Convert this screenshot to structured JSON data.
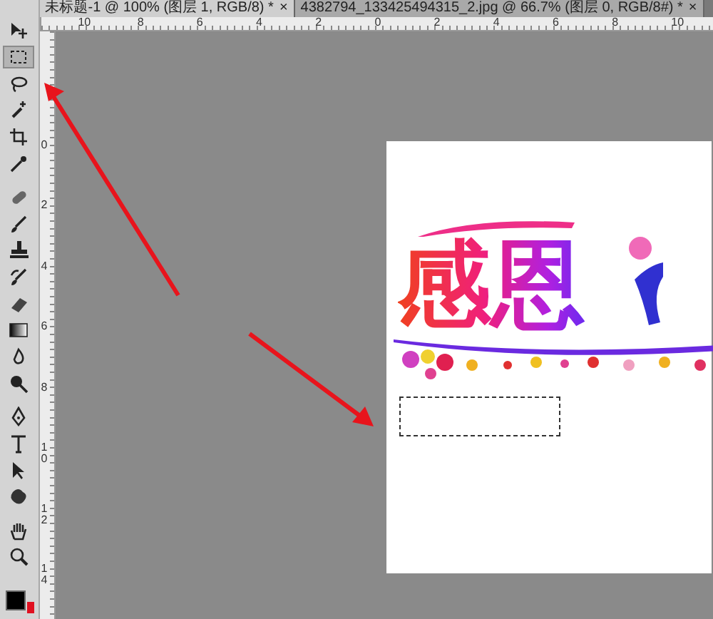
{
  "document_tabs": [
    {
      "label": "未标题-1 @ 100% (图层 1, RGB/8) *",
      "close": "×",
      "selected": true
    },
    {
      "label": "4382794_133425494315_2.jpg @ 66.7% (图层 0, RGB/8#) *",
      "close": "×",
      "selected": false
    }
  ],
  "tools": [
    {
      "kind": "move",
      "selected": false
    },
    {
      "kind": "marquee",
      "selected": true
    },
    {
      "kind": "lasso",
      "selected": false
    },
    {
      "kind": "wand",
      "selected": false
    },
    {
      "kind": "crop",
      "selected": false
    },
    {
      "kind": "eyedropper",
      "selected": false
    },
    {
      "kind": "healing",
      "selected": false
    },
    {
      "kind": "brush",
      "selected": false
    },
    {
      "kind": "stamp",
      "selected": false
    },
    {
      "kind": "history",
      "selected": false
    },
    {
      "kind": "eraser",
      "selected": false
    },
    {
      "kind": "gradient",
      "selected": false
    },
    {
      "kind": "blur",
      "selected": false
    },
    {
      "kind": "dodge",
      "selected": false
    },
    {
      "kind": "pen",
      "selected": false
    },
    {
      "kind": "type",
      "selected": false
    },
    {
      "kind": "path",
      "selected": false
    },
    {
      "kind": "shape",
      "selected": false
    },
    {
      "kind": "hand",
      "selected": false
    },
    {
      "kind": "zoom",
      "selected": false
    }
  ],
  "top_ruler": [
    "10",
    "8",
    "6",
    "4",
    "2",
    "0",
    "2",
    "4",
    "6",
    "8",
    "10"
  ],
  "left_ruler": [
    "0",
    "2",
    "4",
    "6",
    "8",
    "10",
    "12",
    "14"
  ],
  "canvas": {
    "artwork_text": "感恩"
  }
}
